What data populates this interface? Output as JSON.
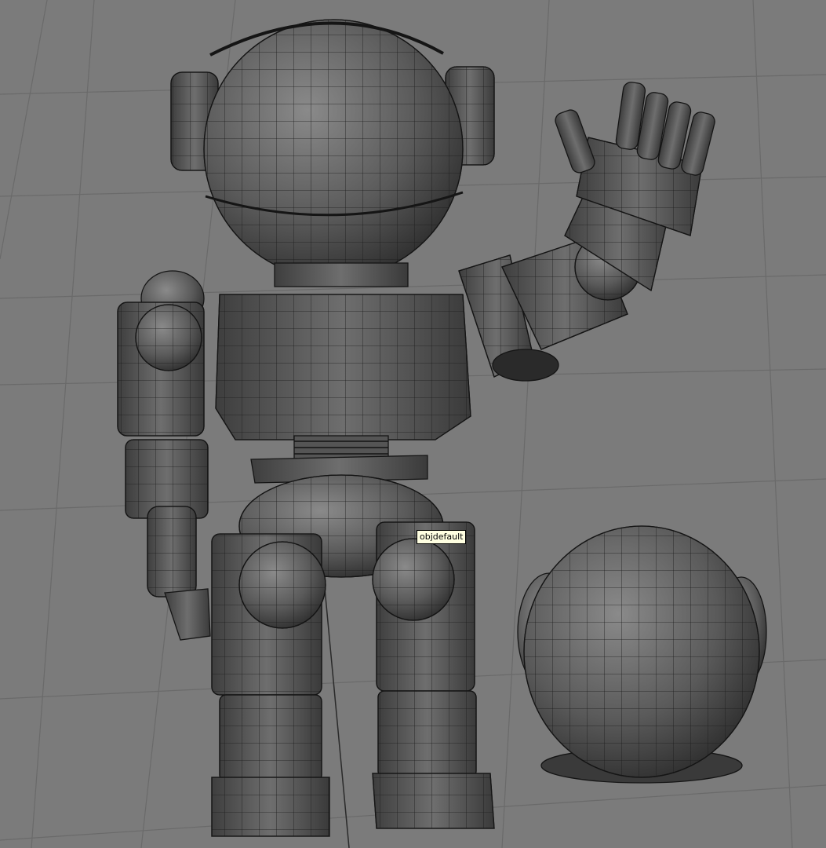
{
  "viewport": {
    "tooltip_text": "objdefault",
    "background_color": "#7b7b7b",
    "grid_color": "#6a6a6a",
    "mesh_fill": "#5f5f5f",
    "mesh_wire": "#1a1a1a",
    "tooltip_bg": "#ffffe1"
  },
  "objects": [
    {
      "name": "robot-body",
      "icon": "robot-mesh"
    },
    {
      "name": "helmet",
      "icon": "sphere-mesh"
    }
  ]
}
